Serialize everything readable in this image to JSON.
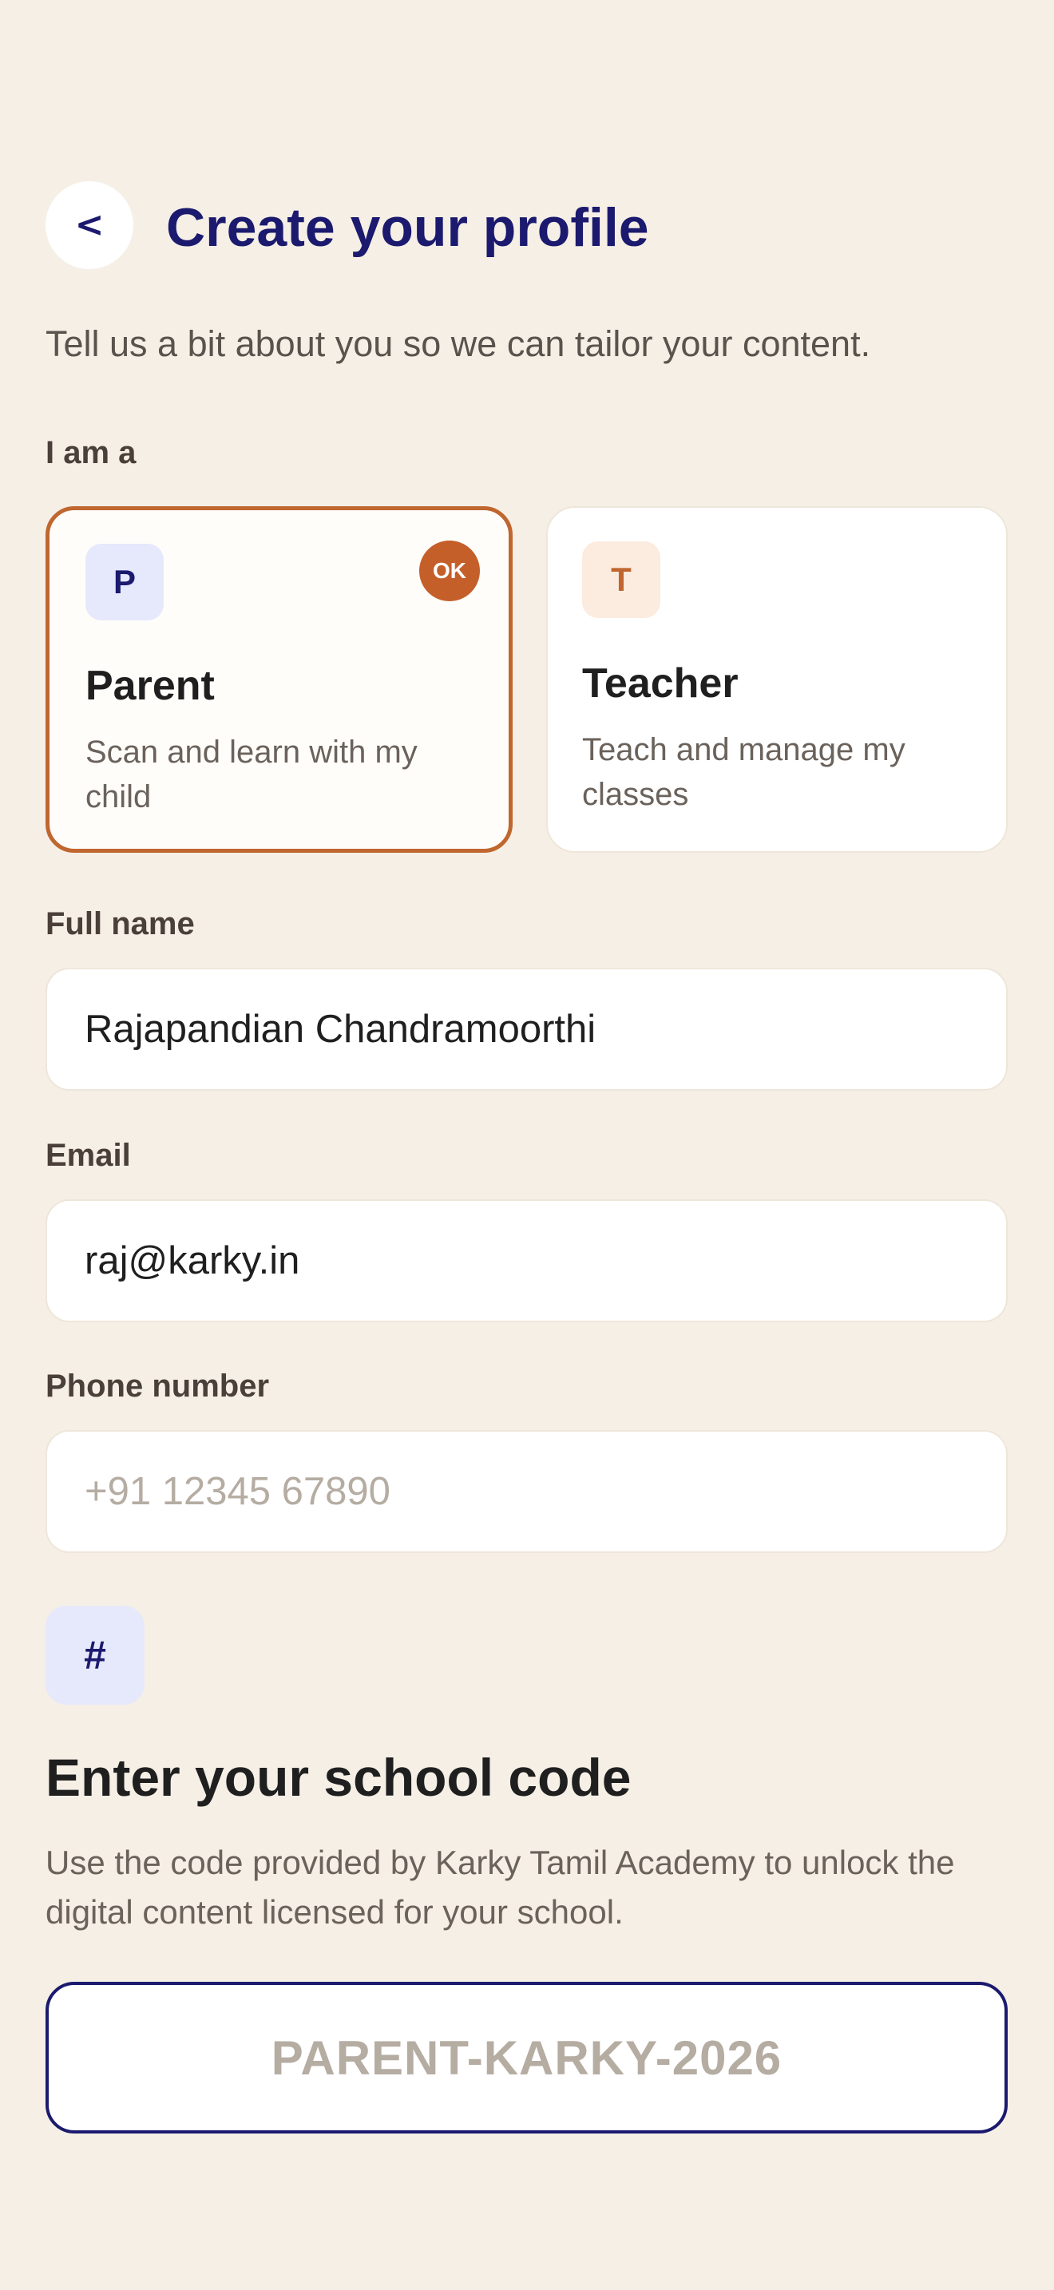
{
  "header": {
    "back_glyph": "<",
    "title": "Create your profile",
    "subtitle": "Tell us a bit about you so we can tailor your content."
  },
  "role_section": {
    "label": "I am a",
    "options": [
      {
        "initial": "P",
        "name": "Parent",
        "description": "Scan and learn with my child",
        "selected": true,
        "badge": "OK"
      },
      {
        "initial": "T",
        "name": "Teacher",
        "description": "Teach and manage my classes",
        "selected": false
      }
    ]
  },
  "fields": {
    "full_name": {
      "label": "Full name",
      "value": "Rajapandian Chandramoorthi"
    },
    "email": {
      "label": "Email",
      "value": "raj@karky.in"
    },
    "phone": {
      "label": "Phone number",
      "value": "",
      "placeholder": "+91 12345 67890"
    }
  },
  "school_code": {
    "icon_glyph": "#",
    "title": "Enter your school code",
    "description": "Use the code provided by Karky Tamil Academy to unlock the digital content licensed for your school.",
    "placeholder": "PARENT-KARKY-2026"
  },
  "colors": {
    "background": "#f5efe6",
    "accent_navy": "#1b1a6e",
    "accent_orange": "#c0662f",
    "card_white": "#ffffff"
  },
  "icons": {
    "back": "back-arrow-icon",
    "ok_badge": "check-badge-icon",
    "hash": "hash-icon"
  }
}
